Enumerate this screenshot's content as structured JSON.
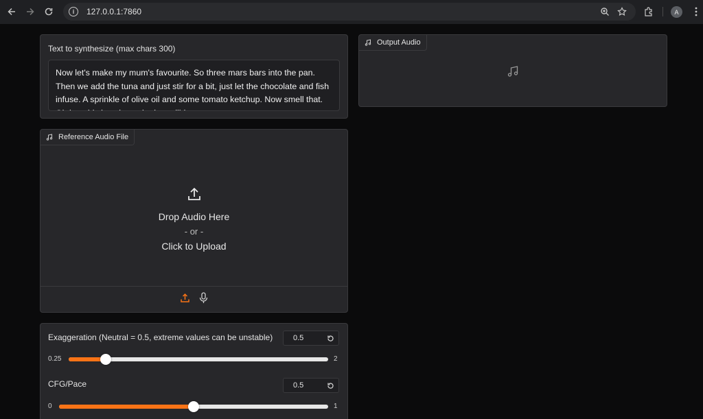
{
  "browser": {
    "url": "127.0.0.1:7860",
    "profile_initial": "A"
  },
  "text_input": {
    "label": "Text to synthesize (max chars 300)",
    "value": "Now let's make my mum's favourite. So three mars bars into the pan. Then we add the tuna and just stir for a bit, just let the chocolate and fish infuse. A sprinkle of olive oil and some tomato ketchup. Now smell that. Oh boy this is going to be incredible."
  },
  "reference_audio": {
    "label": "Reference Audio File",
    "drop_text": "Drop Audio Here",
    "or_text": "- or -",
    "click_text": "Click to Upload"
  },
  "output_audio": {
    "label": "Output Audio"
  },
  "sliders": {
    "exaggeration": {
      "label": "Exaggeration (Neutral = 0.5, extreme values can be unstable)",
      "value": "0.5",
      "min": "0.25",
      "max": "2",
      "fraction": 0.1429
    },
    "cfg": {
      "label": "CFG/Pace",
      "value": "0.5",
      "min": "0",
      "max": "1",
      "fraction": 0.5
    }
  },
  "colors": {
    "accent": "#f97316",
    "panel": "#27272a",
    "background": "#0b0b0c"
  }
}
